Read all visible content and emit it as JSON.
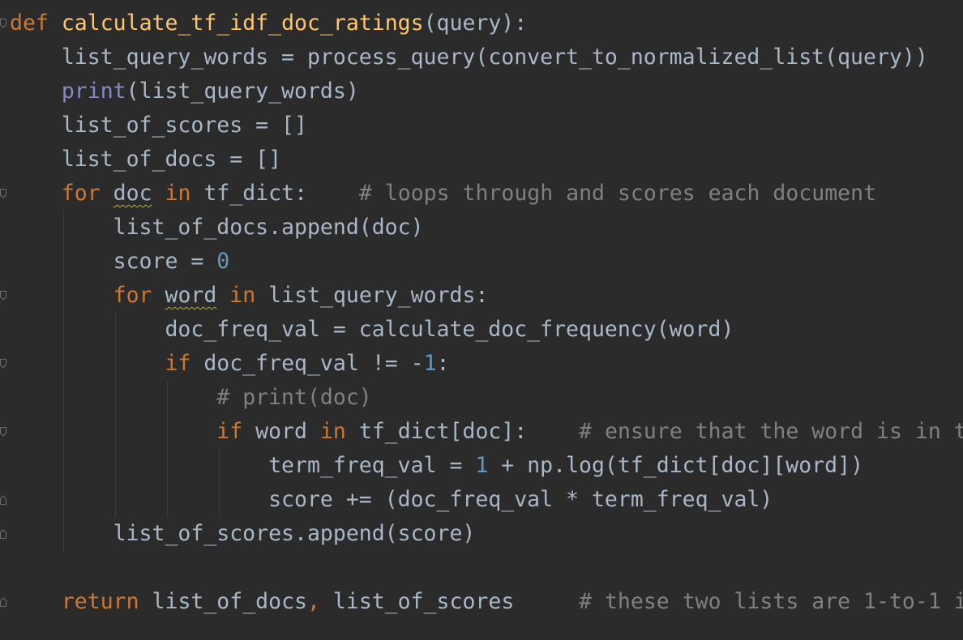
{
  "editor": {
    "language": "python",
    "theme_colors": {
      "background": "#2b2b2b",
      "text": "#a9b7c6",
      "keyword": "#cc7832",
      "function_def": "#ffc66d",
      "builtin": "#8888c6",
      "number": "#6897bb",
      "comment": "#808080"
    },
    "code": {
      "l1": {
        "def": "def",
        "name": "calculate_tf_idf_doc_ratings",
        "args": "(query):"
      },
      "l2": {
        "text": "list_query_words = process_query(convert_to_normalized_list(query))"
      },
      "l3": {
        "print": "print",
        "args": "(list_query_words)"
      },
      "l4": {
        "text": "list_of_scores = []"
      },
      "l5": {
        "text": "list_of_docs = []"
      },
      "l6": {
        "for": "for",
        "var": "doc",
        "in": "in",
        "iter": "tf_dict:",
        "comment": "# loops through and scores each document"
      },
      "l7": {
        "text": "list_of_docs.append(doc)"
      },
      "l8": {
        "text": "score = ",
        "num": "0"
      },
      "l9": {
        "for": "for",
        "var": "word",
        "in": "in",
        "iter": "list_query_words:"
      },
      "l10": {
        "text": "doc_freq_val = calculate_doc_frequency(word)"
      },
      "l11": {
        "if": "if",
        "cond": "doc_freq_val != -",
        "num": "1",
        "colon": ":"
      },
      "l12": {
        "comment": "# print(doc)"
      },
      "l13": {
        "if": "if",
        "word": "word",
        "in": "in",
        "rest": "tf_dict[doc]:",
        "comment": "# ensure that the word is in t"
      },
      "l14": {
        "a": "term_freq_val = ",
        "num": "1",
        "b": " + np.log(tf_dict[doc][word])"
      },
      "l15": {
        "text": "score += (doc_freq_val * term_freq_val)"
      },
      "l16": {
        "text": "list_of_scores.append(score)"
      },
      "l18": {
        "return": "return",
        "a": "list_of_docs",
        "comma": ",",
        "b": " list_of_scores",
        "comment": "# these two lists are 1-to-1 i"
      }
    }
  }
}
